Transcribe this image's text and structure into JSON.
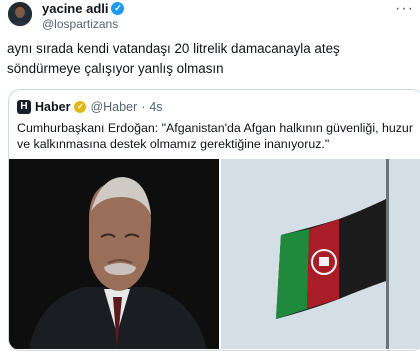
{
  "author": {
    "display_name": "yacine adli",
    "handle": "@lospartizans"
  },
  "tweet": {
    "text": "aynı sırada kendi vatandaşı 20 litrelik damacanayla ateş söndürmeye çalışıyor yanlış olmasın"
  },
  "quote": {
    "logo_letter": "H",
    "name": "Haber",
    "handle": "@Haber",
    "separator": "·",
    "time": "4s",
    "text": "Cumhurbaşkanı Erdoğan: \"Afganistan'da Afgan halkının güvenliği, huzur ve kalkınmasına destek olmamız gerektiğine inanıyoruz.\""
  },
  "icons": {
    "verified": "verified-check-icon",
    "more": "more-options-icon"
  },
  "colors": {
    "verified_blue": "#1d9bf0",
    "verified_gold": "#e2b719",
    "secondary_text": "#536471",
    "border": "#cfd9de"
  }
}
